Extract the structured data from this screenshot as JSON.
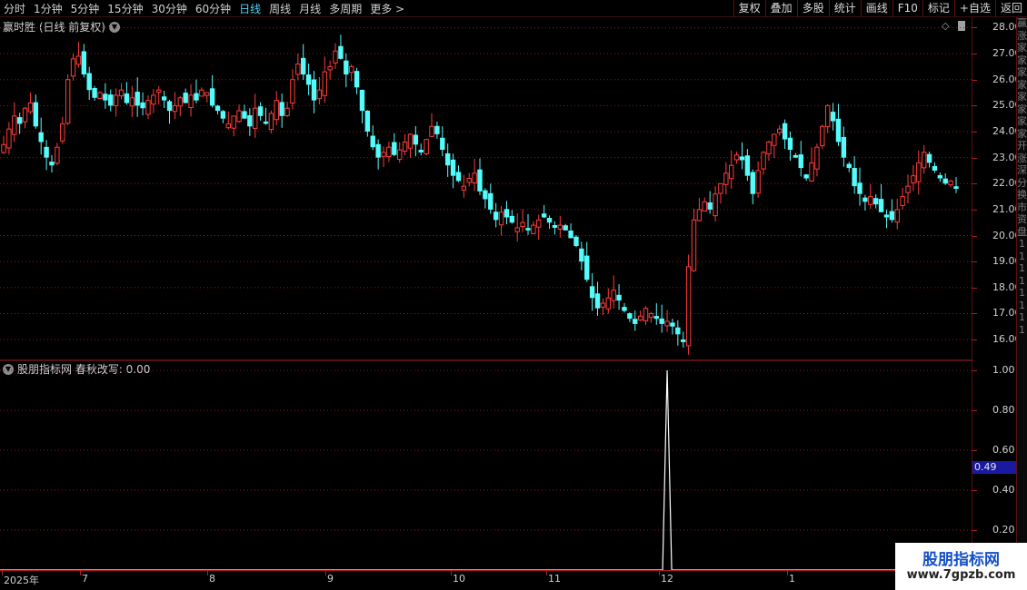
{
  "toolbar": {
    "periods": [
      "分时",
      "1分钟",
      "5分钟",
      "15分钟",
      "30分钟",
      "60分钟",
      "日线",
      "周线",
      "月线",
      "多周期",
      "更多 >"
    ],
    "active_period": "日线",
    "tools": [
      "复权",
      "叠加",
      "多股",
      "统计",
      "画线",
      "F10",
      "标记",
      "+自选",
      "返回"
    ]
  },
  "main_panel": {
    "title": "赢时胜 (日线 前复权)",
    "options_icon": "chevron-down-icon",
    "corner_icons": [
      "diamond-icon",
      "bar-icon"
    ]
  },
  "sub_panel": {
    "title": "股朋指标网  春秋改写: 0.00",
    "options_icon": "chevron-down-icon",
    "current_value": "0.49"
  },
  "side_strip_chars": [
    "赢",
    "涨",
    "家",
    "家",
    "家",
    "家",
    "家",
    "家",
    "家",
    "家",
    "开",
    "涨",
    "深",
    "分",
    "换",
    "市",
    "资",
    "盘",
    "1",
    "1",
    "1",
    "1",
    "1",
    "1",
    "1",
    "1"
  ],
  "date_axis": [
    "2025年",
    "7",
    "8",
    "9",
    "10",
    "11",
    "12",
    "1"
  ],
  "watermark": {
    "title": "股朋指标网",
    "url": "www.7gpzb.com"
  },
  "colors": {
    "up": "#ff3c3c",
    "down": "#54fcfc",
    "grid": "#8c1a1a",
    "line": "#ffffff",
    "badge": "#1a1aa0"
  },
  "chart_data": [
    {
      "type": "candlestick",
      "title": "赢时胜 (日线 前复权)",
      "y_ticks": [
        16.0,
        17.0,
        18.0,
        19.0,
        20.0,
        21.0,
        22.0,
        23.0,
        24.0,
        25.0,
        26.0,
        27.0,
        28.0
      ],
      "ylim": [
        15.2,
        28.4
      ],
      "x_ticks": [
        "2025年",
        "7",
        "8",
        "9",
        "10",
        "11",
        "12",
        "1"
      ],
      "closes": [
        23.5,
        24.1,
        24.6,
        24.3,
        24.9,
        25.1,
        24.2,
        23.6,
        23.0,
        22.7,
        23.4,
        24.3,
        26.0,
        26.8,
        26.9,
        26.2,
        25.6,
        25.3,
        25.5,
        25.2,
        25.0,
        25.4,
        25.6,
        25.1,
        25.3,
        25.0,
        24.9,
        25.2,
        25.4,
        25.6,
        25.2,
        24.8,
        25.0,
        25.3,
        25.1,
        25.4,
        25.2,
        25.6,
        25.5,
        25.0,
        24.8,
        24.5,
        24.3,
        24.6,
        24.8,
        24.5,
        24.2,
        24.9,
        24.6,
        24.3,
        24.7,
        25.2,
        24.6,
        24.9,
        26.0,
        26.6,
        26.2,
        25.8,
        25.2,
        25.6,
        26.3,
        26.5,
        27.1,
        26.8,
        26.2,
        26.5,
        25.7,
        24.8,
        24.0,
        23.4,
        23.0,
        23.2,
        23.4,
        23.1,
        23.3,
        23.6,
        23.9,
        23.5,
        23.2,
        23.7,
        24.2,
        23.9,
        23.3,
        22.7,
        22.3,
        22.1,
        21.9,
        22.2,
        22.4,
        21.7,
        21.4,
        21.0,
        20.6,
        20.9,
        20.7,
        20.5,
        20.3,
        20.5,
        20.2,
        20.4,
        20.6,
        20.7,
        20.5,
        20.3,
        20.4,
        20.2,
        19.9,
        19.6,
        19.0,
        18.3,
        17.6,
        17.2,
        17.4,
        17.6,
        17.9,
        17.5,
        17.1,
        16.8,
        16.6,
        16.9,
        17.2,
        17.0,
        16.8,
        16.6,
        16.7,
        16.5,
        16.2,
        15.9,
        18.8,
        20.6,
        21.0,
        21.3,
        21.0,
        21.6,
        22.0,
        22.4,
        22.7,
        23.1,
        22.9,
        22.3,
        21.6,
        22.5,
        23.2,
        23.6,
        23.9,
        24.1,
        23.7,
        23.3,
        23.0,
        22.6,
        22.2,
        22.8,
        23.4,
        24.2,
        25.0,
        24.4,
        23.6,
        23.0,
        22.6,
        21.9,
        21.6,
        21.3,
        21.5,
        21.2,
        20.9,
        20.7,
        20.6,
        21.0,
        21.5,
        21.9,
        22.3,
        22.8,
        23.2,
        22.8,
        22.5,
        22.2,
        22.0,
        22.1,
        21.8
      ]
    },
    {
      "type": "line",
      "title": "股朋指标网  春秋改写: 0.00",
      "y_ticks": [
        0.2,
        0.4,
        0.6,
        0.8,
        1.0
      ],
      "ylim": [
        0.0,
        1.05
      ],
      "series": [
        {
          "name": "春秋改写",
          "spike_index": 124,
          "spike_value": 1.0,
          "baseline": 0.0
        }
      ]
    }
  ]
}
